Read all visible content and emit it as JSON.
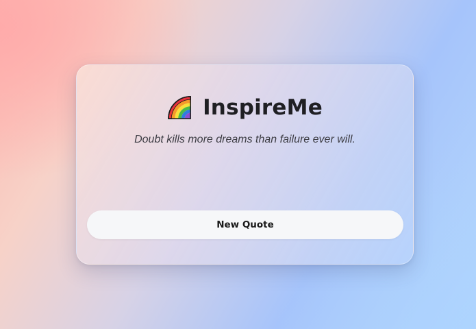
{
  "app": {
    "title": "InspireMe",
    "icon": "rainbow-icon"
  },
  "quote": {
    "text": "Doubt kills more dreams than failure ever will."
  },
  "actions": {
    "new_quote_label": "New Quote"
  }
}
